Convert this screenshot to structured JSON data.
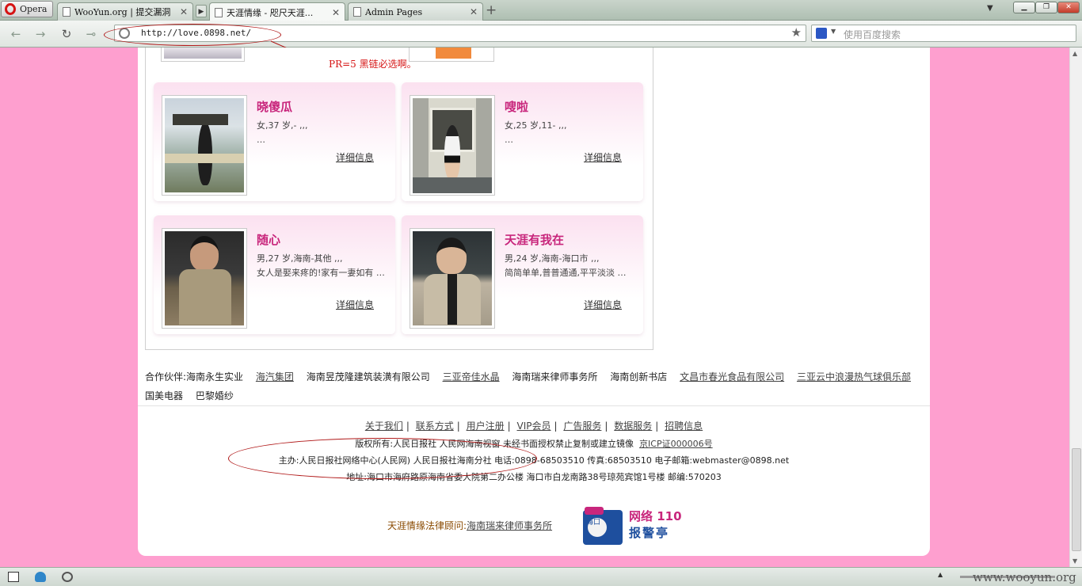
{
  "browser": {
    "menu_label": "Opera",
    "tabs": [
      {
        "label": "WooYun.org | 提交漏洞"
      },
      {
        "label": "天涯情缘 - 咫尺天涯..."
      },
      {
        "label": "Admin Pages"
      }
    ],
    "url": "http://love.0898.net/",
    "search_placeholder": "使用百度搜索"
  },
  "annotation": "PR=5 黑链必选啊。",
  "cards": [
    {
      "name": "晓傻瓜",
      "info": "女,37 岁,- ,,,",
      "desc": "…",
      "detail": "详细信息"
    },
    {
      "name": "嗖啦",
      "info": "女,25 岁,11- ,,,",
      "desc": "…",
      "detail": "详细信息"
    },
    {
      "name": "随心",
      "info": "男,27 岁,海南-其他 ,,,",
      "desc": "女人是娶来疼的!家有一妻如有 …",
      "detail": "详细信息"
    },
    {
      "name": "天涯有我在",
      "info": "男,24 岁,海南-海口市 ,,,",
      "desc": "简简单单,普普通通,平平淡淡 …",
      "detail": "详细信息"
    }
  ],
  "partners": {
    "label": "合作伙伴:海南永生实业",
    "items": [
      "海汽集团",
      "海南昱茂隆建筑装潢有限公司",
      "三亚帝佳水晶",
      "海南瑞来律师事务所",
      "海南创新书店",
      "文昌市春光食品有限公司",
      "三亚云中浪漫热气球俱乐部",
      "国美电器",
      "巴黎婚纱"
    ]
  },
  "footer": {
    "links": [
      "关于我们",
      "联系方式",
      "用户注册",
      "VIP会员",
      "广告服务",
      "数据服务",
      "招聘信息"
    ],
    "copyright": "版权所有:人民日报社  人民网海南视窗 未经书面授权禁止复制或建立镜像",
    "icp": "京ICP证000006号",
    "host": "主办:人民日报社网络中心(人民网) 人民日报社海南分社 电话:0898-68503510 传真:68503510   电子邮箱:webmaster@0898.net",
    "address": "地址:海口市海府路原海南省委大院第二办公楼 海口市白龙南路38号琼苑宾馆1号楼 邮编:570203",
    "legal_label": "天涯情缘法律顾问:",
    "legal_link": "海南瑞来律师事务所",
    "police_line1": "网络 110",
    "police_line2": "报警亭",
    "police_badge": "海口"
  },
  "watermark": "www.wooyun.org"
}
